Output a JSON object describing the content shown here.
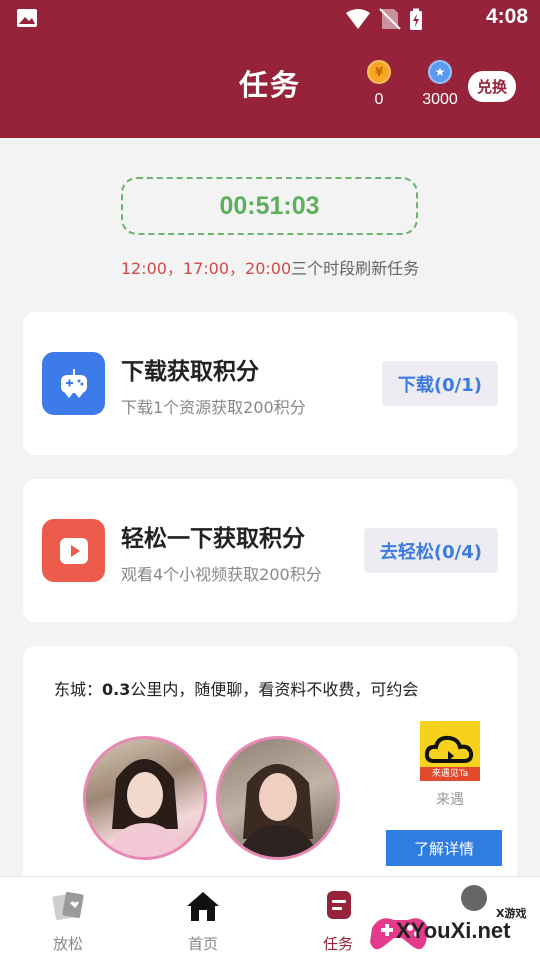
{
  "status_bar": {
    "time": "4:08"
  },
  "header": {
    "title": "任务",
    "gold_coin": {
      "symbol": "¥",
      "value": "0"
    },
    "points": {
      "symbol": "★",
      "value": "3000"
    },
    "exchange_label": "兑换"
  },
  "timer": {
    "countdown": "00:51:03",
    "refresh_times": "12:00，17:00，20:00",
    "refresh_text": "三个时段刷新任务"
  },
  "tasks": [
    {
      "title": "下载获取积分",
      "desc": "下载1个资源获取200积分",
      "button": "下载(0/1)",
      "icon": "gamepad-icon",
      "color": "#3d7be8"
    },
    {
      "title": "轻松一下获取积分",
      "desc": "观看4个小视频获取200积分",
      "button": "去轻松(0/4)",
      "icon": "play-video-icon",
      "color": "#ec5b4c"
    }
  ],
  "ad": {
    "location": "东城：",
    "distance": "0.3",
    "text": "公里内，随便聊，看资料不收费，可约会",
    "app_logo_text": "来遇见Ta",
    "app_name": "来遇",
    "detail_button": "了解详情"
  },
  "tab_bar": [
    {
      "label": "放松",
      "icon": "cards-icon"
    },
    {
      "label": "首页",
      "icon": "home-icon"
    },
    {
      "label": "任务",
      "icon": "task-icon"
    }
  ],
  "watermark": {
    "brand": "XYouXi.net",
    "small": "X游戏"
  },
  "colors": {
    "header": "#96233a",
    "timer_green": "#5fae5c",
    "button_blue": "#3d7be0"
  }
}
